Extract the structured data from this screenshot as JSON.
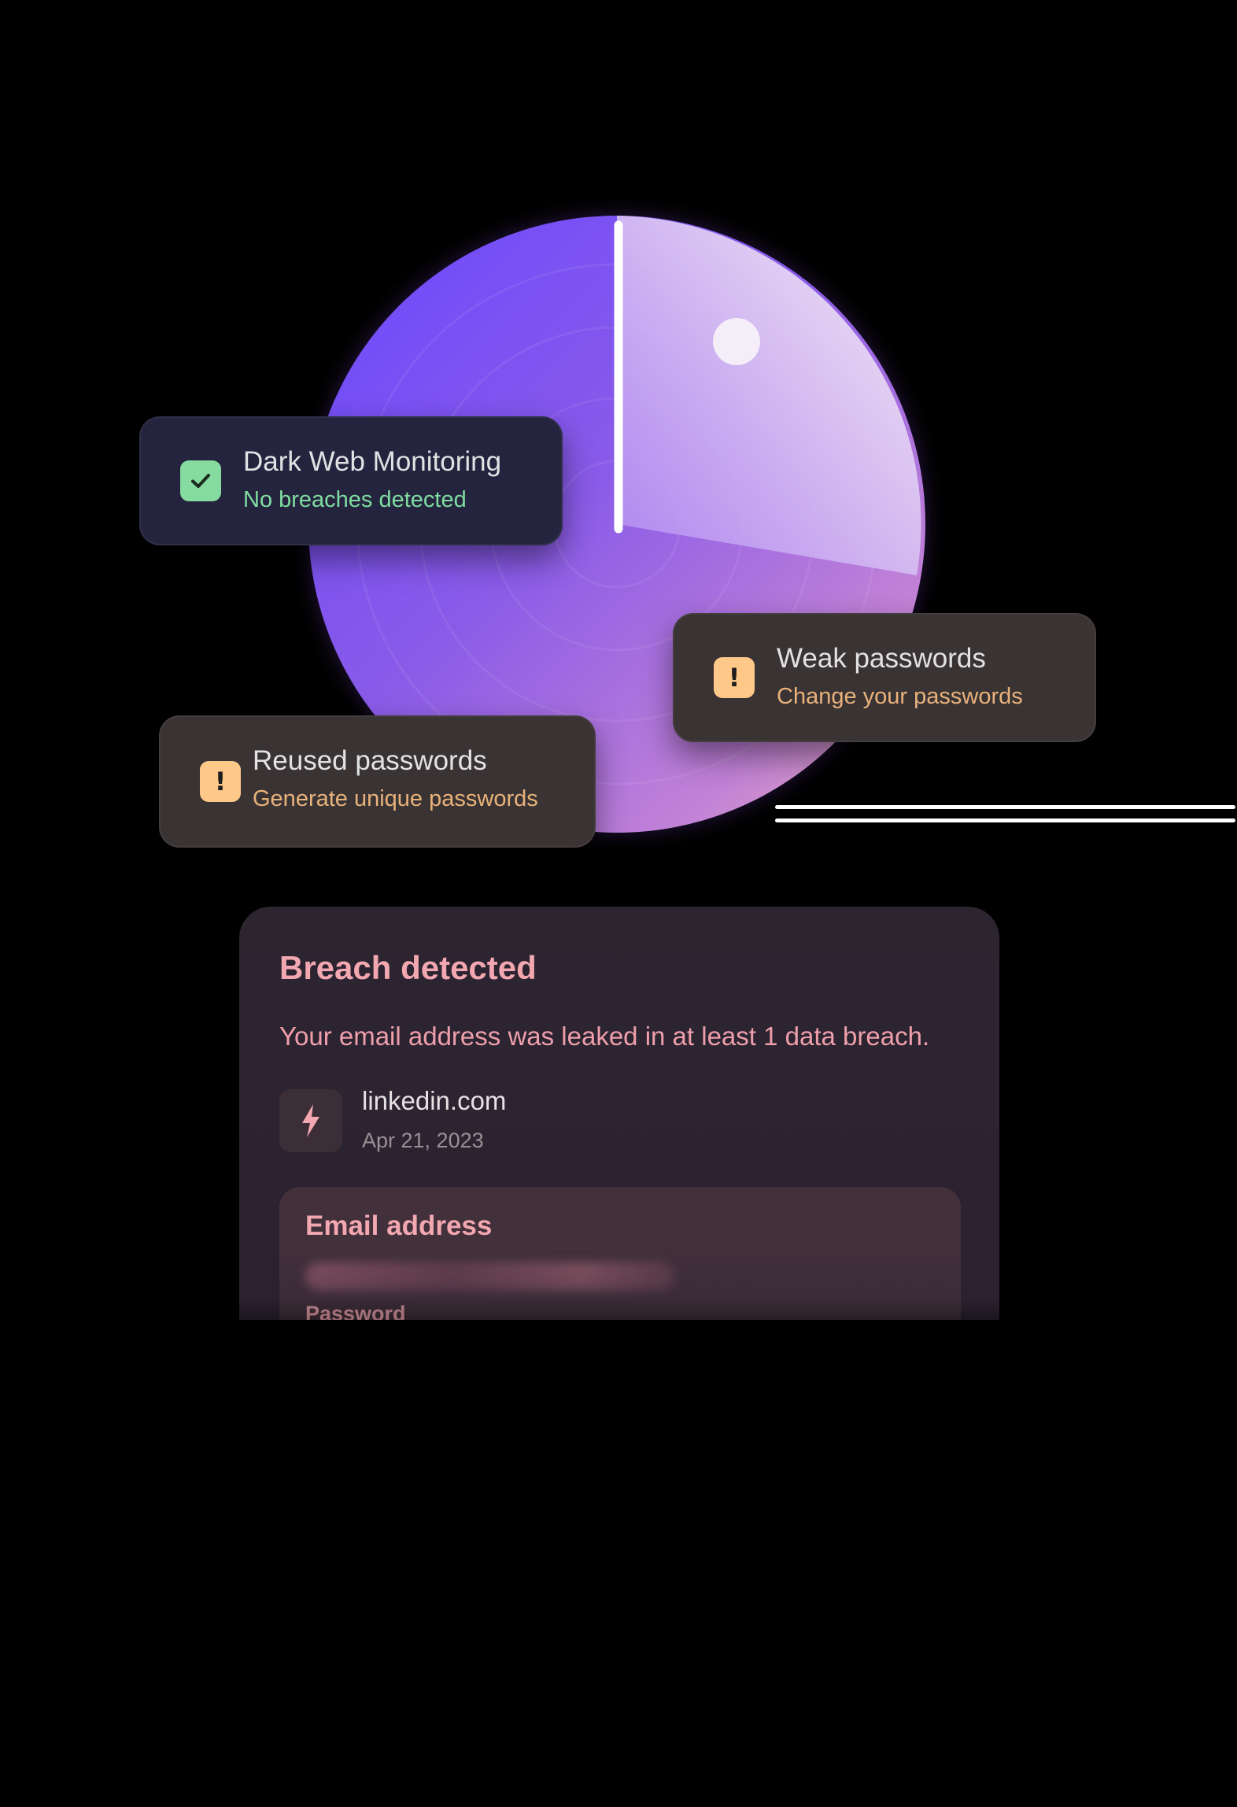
{
  "colors": {
    "radar_violet": "#6e4bff",
    "radar_pink": "#c48ad8",
    "ok_green": "#86dca0",
    "warn_amber": "#fdc888",
    "breach_pink": "#f2a7b1"
  },
  "status_cards": {
    "dark_web": {
      "icon": "checkmark-icon",
      "title": "Dark Web Monitoring",
      "subtitle": "No breaches detected"
    },
    "weak": {
      "icon": "exclamation-icon",
      "title": "Weak passwords",
      "subtitle": "Change your passwords"
    },
    "reused": {
      "icon": "exclamation-icon",
      "title": "Reused passwords",
      "subtitle": "Generate unique passwords"
    }
  },
  "breach": {
    "title": "Breach detected",
    "description": "Your email address was leaked in at least 1 data breach.",
    "site": {
      "icon": "lightning-icon",
      "name": "linkedin.com",
      "date": "Apr 21, 2023"
    },
    "details": {
      "email_label": "Email address",
      "password_label": "Password"
    }
  }
}
